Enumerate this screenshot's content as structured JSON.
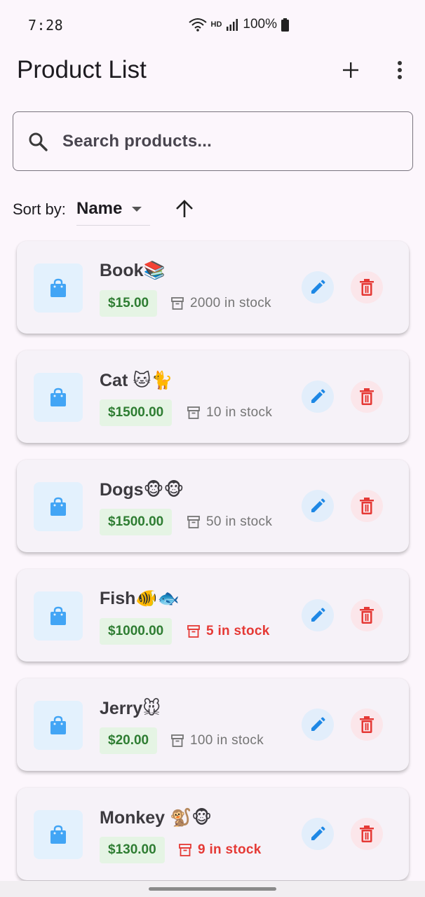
{
  "status": {
    "time": "7:28",
    "battery": "100%",
    "network_badge": "HD"
  },
  "app_bar": {
    "title": "Product List",
    "add_icon": "add-icon",
    "menu_icon": "more-vert-icon"
  },
  "search": {
    "placeholder": "Search products...",
    "value": ""
  },
  "sort": {
    "label": "Sort by:",
    "selected": "Name",
    "direction_icon": "arrow-up-icon"
  },
  "colors": {
    "price_bg": "#e5f4e4",
    "price_text": "#2e7d32",
    "low_stock": "#e53935",
    "normal_stock": "#757575",
    "thumb_bg": "#e3f1fd",
    "thumb_icon": "#42a5f5",
    "edit_bg": "#e2eefb",
    "edit_icon": "#1e88e5",
    "delete_bg": "#fbe6ea",
    "delete_icon": "#e53935"
  },
  "products": [
    {
      "name": "Book📚",
      "price": "$15.00",
      "stock": "2000 in stock",
      "low": false
    },
    {
      "name": "Cat 🐱🐈",
      "price": "$1500.00",
      "stock": "10 in stock",
      "low": false
    },
    {
      "name": "Dogs🐵🐵",
      "price": "$1500.00",
      "stock": "50 in stock",
      "low": false
    },
    {
      "name": "Fish🐠🐟",
      "price": "$1000.00",
      "stock": "5 in stock",
      "low": true
    },
    {
      "name": "Jerry🐭",
      "price": "$20.00",
      "stock": "100 in stock",
      "low": false
    },
    {
      "name": "Monkey 🐒🐵",
      "price": "$130.00",
      "stock": "9 in stock",
      "low": true
    }
  ]
}
